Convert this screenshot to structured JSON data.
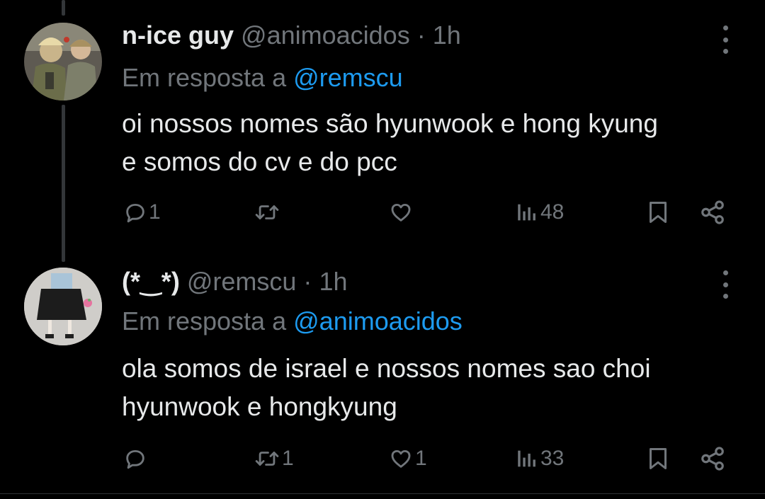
{
  "tweets": [
    {
      "display_name": "n-ice guy",
      "handle": "@animoacidos",
      "separator": "·",
      "time": "1h",
      "reply_prefix": "Em resposta a",
      "reply_handle": "@remscu",
      "text": "oi nossos nomes são hyunwook e hong kyung\ne somos do cv e do pcc",
      "replies": "1",
      "retweets": "",
      "likes": "",
      "views": "48"
    },
    {
      "display_name": "(*‿*)",
      "handle": "@remscu",
      "separator": "·",
      "time": "1h",
      "reply_prefix": "Em resposta a",
      "reply_handle": "@animoacidos",
      "text": "ola somos de israel e nossos nomes sao choi\nhyunwook e hongkyung",
      "replies": "",
      "retweets": "1",
      "likes": "1",
      "views": "33"
    }
  ],
  "icons": {
    "reply": "reply-icon",
    "retweet": "retweet-icon",
    "like": "heart-icon",
    "views": "views-icon",
    "bookmark": "bookmark-icon",
    "share": "share-icon",
    "more": "more-icon"
  },
  "colors": {
    "background": "#000000",
    "text": "#e7e9ea",
    "secondary": "#71767b",
    "link": "#1d9bf0",
    "thread_line": "#333639"
  }
}
